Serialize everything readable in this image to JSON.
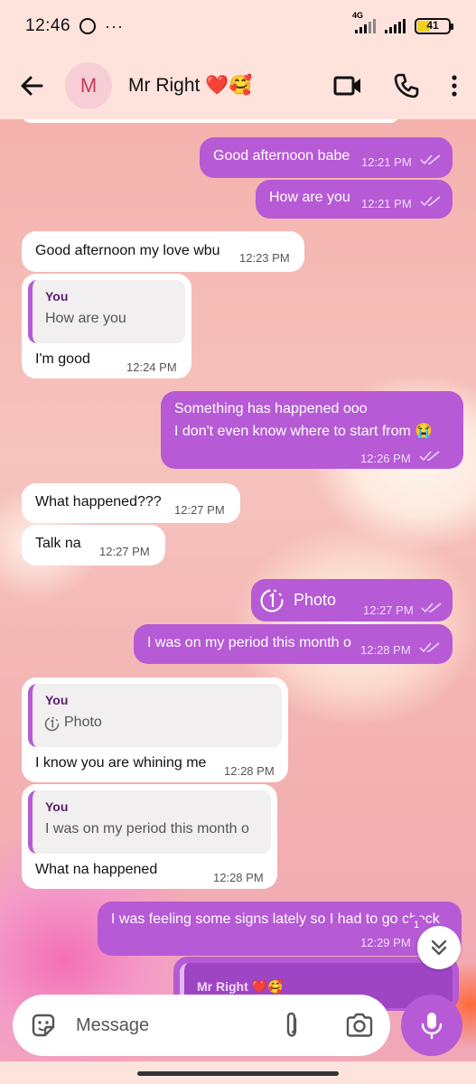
{
  "status_bar": {
    "time": "12:46",
    "network": "4G",
    "battery": "41",
    "battery_level": 0.41
  },
  "header": {
    "avatar_initial": "M",
    "contact_name": "Mr Right ❤️🥰"
  },
  "messages": [
    {
      "text": "Good afternoon babe",
      "time": "12:21 PM"
    },
    {
      "text": "How are you",
      "time": "12:21 PM"
    },
    {
      "text": "Good afternoon my love wbu",
      "time": "12:23 PM"
    },
    {
      "quote_name": "You",
      "quote_text": "How are you",
      "text": "I'm good",
      "time": "12:24 PM"
    },
    {
      "text_line1": "Something has happened ooo",
      "text_line2": "I don't even know where to start from 😭",
      "time": "12:26 PM"
    },
    {
      "text": "What happened???",
      "time": "12:27 PM"
    },
    {
      "text": "Talk na",
      "time": "12:27 PM"
    },
    {
      "text": "Photo",
      "time": "12:27 PM"
    },
    {
      "text": "I was on my period this month o",
      "time": "12:28 PM"
    },
    {
      "quote_name": "You",
      "quote_text": "Photo",
      "text": "I know you are whining me",
      "time": "12:28 PM"
    },
    {
      "quote_name": "You",
      "quote_text": "I was on my period this month o",
      "text": "What na happened",
      "time": "12:28 PM"
    },
    {
      "text": "I was feeling some signs lately so I had to go check",
      "time": "12:29 PM"
    },
    {
      "quote_name": "Mr Right ❤️🥰"
    }
  ],
  "unread_count": "1",
  "input": {
    "placeholder": "Message"
  },
  "colors": {
    "accent": "#b65ad6",
    "header_bg": "#fde3dc",
    "tick": "#e7c7f2"
  }
}
